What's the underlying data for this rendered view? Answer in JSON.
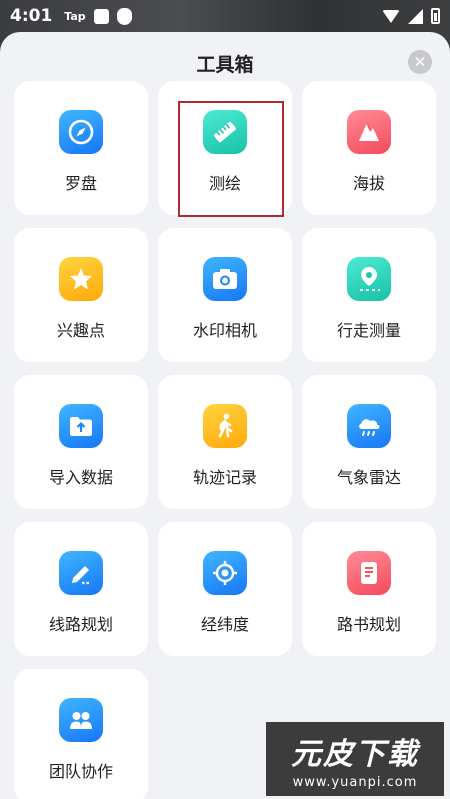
{
  "status_bar": {
    "time": "4:01",
    "app_badge": "Tap"
  },
  "sheet": {
    "title": "工具箱",
    "close_glyph": "✕"
  },
  "tools": [
    {
      "label": "罗盘",
      "icon": "compass-icon",
      "color": "#1e88f5"
    },
    {
      "label": "测绘",
      "icon": "ruler-icon",
      "color": "#1cc8ae",
      "selected": true
    },
    {
      "label": "海拔",
      "icon": "mountain-icon",
      "color": "#f4515f"
    },
    {
      "label": "兴趣点",
      "icon": "star-icon",
      "color": "#ffb516"
    },
    {
      "label": "水印相机",
      "icon": "camera-icon",
      "color": "#1e88f5"
    },
    {
      "label": "行走测量",
      "icon": "location-pin-icon",
      "color": "#1cc8ae"
    },
    {
      "label": "导入数据",
      "icon": "folder-upload-icon",
      "color": "#1e88f5"
    },
    {
      "label": "轨迹记录",
      "icon": "walking-person-icon",
      "color": "#ffb516"
    },
    {
      "label": "气象雷达",
      "icon": "rain-cloud-icon",
      "color": "#1e88f5"
    },
    {
      "label": "线路规划",
      "icon": "pencil-icon",
      "color": "#1e88f5"
    },
    {
      "label": "经纬度",
      "icon": "crosshair-icon",
      "color": "#1e88f5"
    },
    {
      "label": "路书规划",
      "icon": "notebook-icon",
      "color": "#f4515f"
    },
    {
      "label": "团队协作",
      "icon": "team-icon",
      "color": "#1e88f5"
    }
  ],
  "watermark": {
    "title": "元皮下载",
    "url": "www.yuanpi.com"
  }
}
